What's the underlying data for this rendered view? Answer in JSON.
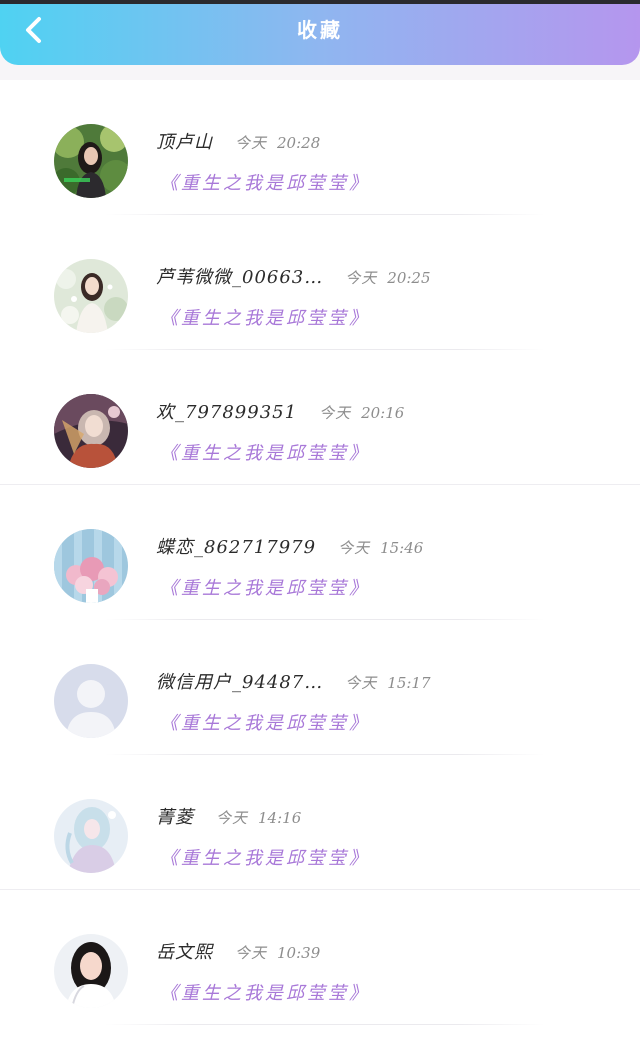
{
  "header": {
    "title": "收藏",
    "back_icon": "chevron-left-icon",
    "gradient_colors": [
      "#4fd2f2",
      "#b596ee"
    ]
  },
  "accent_color": "#a878d8",
  "favorites": [
    {
      "name": "顶卢山",
      "time_label": "今天",
      "time": "20:28",
      "book": "《重生之我是邱莹莹》",
      "avatar": "photo-girl-garden"
    },
    {
      "name": "芦苇微微_00663…",
      "time_label": "今天",
      "time": "20:25",
      "book": "《重生之我是邱莹莹》",
      "avatar": "photo-girl-light"
    },
    {
      "name": "欢_797899351",
      "time_label": "今天",
      "time": "20:16",
      "book": "《重生之我是邱莹莹》",
      "avatar": "anime-art"
    },
    {
      "name": "蝶恋_862717979",
      "time_label": "今天",
      "time": "15:46",
      "book": "《重生之我是邱莹莹》",
      "avatar": "flowers-photo"
    },
    {
      "name": "微信用户_94487…",
      "time_label": "今天",
      "time": "15:17",
      "book": "《重生之我是邱莹莹》",
      "avatar": "default-user"
    },
    {
      "name": "菁菱",
      "time_label": "今天",
      "time": "14:16",
      "book": "《重生之我是邱莹莹》",
      "avatar": "anime-fairy"
    },
    {
      "name": "岳文熙",
      "time_label": "今天",
      "time": "10:39",
      "book": "《重生之我是邱莹莹》",
      "avatar": "photo-girl-portrait"
    }
  ]
}
